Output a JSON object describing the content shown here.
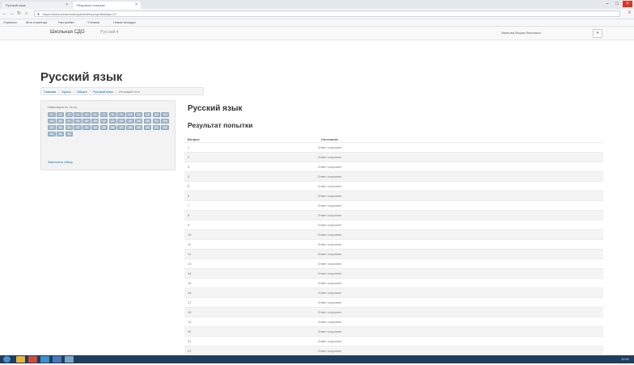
{
  "browser": {
    "tabs": [
      {
        "label": "Русский язык"
      },
      {
        "label": "Результат попытки"
      }
    ],
    "url": "https://school.edu/mod/quiz/review.php?attempt=17",
    "bookmarks": [
      "Сервисы",
      "Моя страница",
      "Настройки",
      "Ученики",
      "Новая вкладка"
    ]
  },
  "site": {
    "brand": "Школьная СДО",
    "menu": "Русский ▾",
    "user_name": "Иванова Мария Ивановна",
    "user_button": "▾"
  },
  "page": {
    "title": "Русский язык",
    "breadcrumb": [
      "Главная",
      "Курсы",
      "Общее",
      "Русский язык",
      "Итоговый тест"
    ]
  },
  "quiz_nav": {
    "caption": "Навигация по тесту",
    "questions": [
      "1",
      "2",
      "3",
      "4",
      "5",
      "6",
      "7",
      "8",
      "9",
      "10",
      "11",
      "12",
      "13",
      "14",
      "15",
      "16",
      "17",
      "18",
      "19",
      "20",
      "21",
      "22",
      "23",
      "24",
      "25",
      "26",
      "27",
      "28",
      "29",
      "30",
      "31",
      "32",
      "33",
      "34",
      "35",
      "36",
      "37",
      "38",
      "39",
      "40",
      "41",
      "42",
      "43",
      "44",
      "45"
    ],
    "finish_link": "Закончить обзор"
  },
  "results": {
    "heading": "Русский язык",
    "subheading": "Результат попытки",
    "col_question": "Вопрос",
    "col_status": "Состояние",
    "rows": [
      {
        "q": "1",
        "status": "Ответ сохранен"
      },
      {
        "q": "2",
        "status": "Ответ сохранен"
      },
      {
        "q": "3",
        "status": "Ответ сохранен"
      },
      {
        "q": "4",
        "status": "Ответ сохранен"
      },
      {
        "q": "5",
        "status": "Ответ сохранен"
      },
      {
        "q": "6",
        "status": "Ответ сохранен"
      },
      {
        "q": "7",
        "status": "Ответ сохранен"
      },
      {
        "q": "8",
        "status": "Ответ сохранен"
      },
      {
        "q": "9",
        "status": "Ответ сохранен"
      },
      {
        "q": "10",
        "status": "Ответ сохранен"
      },
      {
        "q": "11",
        "status": "Ответ сохранен"
      },
      {
        "q": "12",
        "status": "Ответ сохранен"
      },
      {
        "q": "13",
        "status": "Ответ сохранен"
      },
      {
        "q": "14",
        "status": "Ответ сохранен"
      },
      {
        "q": "15",
        "status": "Ответ сохранен"
      },
      {
        "q": "16",
        "status": "Ответ сохранен"
      },
      {
        "q": "17",
        "status": "Ответ сохранен"
      },
      {
        "q": "18",
        "status": "Ответ сохранен"
      },
      {
        "q": "19",
        "status": "Ответ сохранен"
      },
      {
        "q": "20",
        "status": "Ответ сохранен"
      },
      {
        "q": "21",
        "status": "Ответ сохранен"
      },
      {
        "q": "22",
        "status": "Ответ сохранен"
      },
      {
        "q": "23",
        "status": "Ответ сохранен"
      }
    ]
  },
  "taskbar": {
    "clock": "12:41"
  },
  "colors": {
    "link": "#0070a8",
    "nav_button": "#a9bed1",
    "taskbar": "#1f3d5c"
  }
}
